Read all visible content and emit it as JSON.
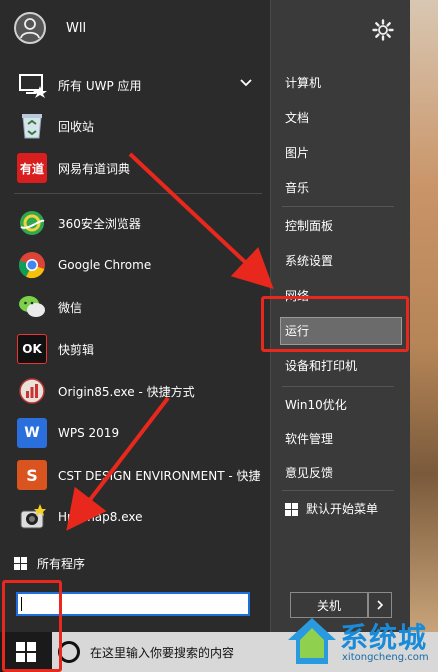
{
  "user": {
    "name": "Wll"
  },
  "left_list": [
    {
      "label": "所有 UWP 应用",
      "icon": "monitor-star-icon"
    },
    {
      "label": "回收站",
      "icon": "recycle-bin-icon"
    },
    {
      "label": "网易有道词典",
      "icon": "youdao-icon",
      "icon_text": "有道"
    },
    {
      "label": "360安全浏览器",
      "icon": "360-browser-icon"
    },
    {
      "label": "Google Chrome",
      "icon": "chrome-icon"
    },
    {
      "label": "微信",
      "icon": "wechat-icon"
    },
    {
      "label": "快剪辑",
      "icon": "kuaijianji-icon",
      "icon_text": "OK"
    },
    {
      "label": "Origin85.exe - 快捷方式",
      "icon": "origin-icon"
    },
    {
      "label": "WPS 2019",
      "icon": "wps-icon",
      "icon_text": "W"
    },
    {
      "label": "CST DESIGN ENVIRONMENT - 快捷",
      "icon": "cst-icon",
      "icon_text": "S"
    },
    {
      "label": "HprSnap8.exe",
      "icon": "hypersnap-icon"
    }
  ],
  "all_programs": "所有程序",
  "right_list": [
    "计算机",
    "文档",
    "图片",
    "音乐",
    "控制面板",
    "系统设置",
    "网络",
    "运行",
    "设备和打印机",
    "Win10优化",
    "软件管理",
    "意见反馈",
    "默认开始菜单"
  ],
  "shutdown_label": "关机",
  "taskbar": {
    "search_hint": "在这里输入你要搜索的内容"
  },
  "watermark": {
    "title": "系统城",
    "url": "xitongcheng.com"
  },
  "colors": {
    "menu_bg": "#2b2b2b",
    "right_pane_bg": "#3a3a3a",
    "annotation_red": "#e8281c",
    "accent_blue": "#1e6fd9"
  }
}
